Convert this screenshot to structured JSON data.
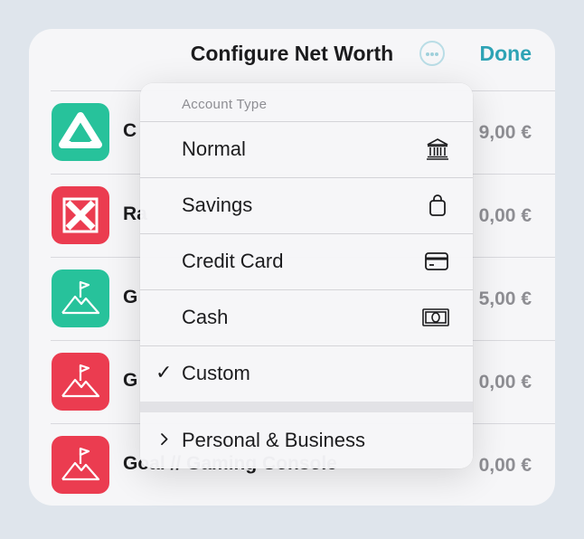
{
  "header": {
    "title": "Configure Net Worth",
    "done_label": "Done"
  },
  "accounts": [
    {
      "name": "C",
      "amount": "9,00 €",
      "color": "#27c29b",
      "icon": "drive-triangle-icon"
    },
    {
      "name": "Ra",
      "amount": "0,00 €",
      "color": "#eb3c50",
      "icon": "crossed-tools-icon"
    },
    {
      "name": "G",
      "amount": "5,00 €",
      "color": "#27c29b",
      "icon": "mountain-flag-icon"
    },
    {
      "name": "G",
      "amount": "0,00 €",
      "color": "#eb3c50",
      "icon": "mountain-flag-icon"
    },
    {
      "name": "Goal // Gaming Console",
      "amount": "0,00 €",
      "color": "#eb3c50",
      "icon": "mountain-flag-icon"
    }
  ],
  "menu": {
    "header": "Account Type",
    "items": [
      {
        "label": "Normal",
        "icon": "bank-icon"
      },
      {
        "label": "Savings",
        "icon": "bag-icon"
      },
      {
        "label": "Credit Card",
        "icon": "credit-card-icon"
      },
      {
        "label": "Cash",
        "icon": "banknote-icon"
      },
      {
        "label": "Custom",
        "selected": true
      }
    ],
    "submenu": {
      "label": "Personal & Business",
      "icon": "chevron-right-icon"
    }
  }
}
